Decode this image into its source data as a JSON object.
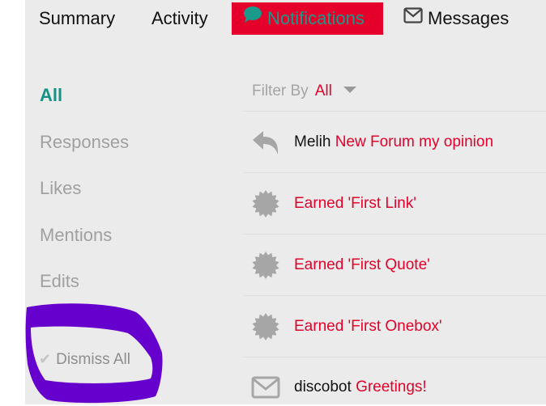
{
  "tabs": {
    "summary": "Summary",
    "activity": "Activity",
    "notifications": "Notifications",
    "messages": "Messages"
  },
  "nav": {
    "all": "All",
    "responses": "Responses",
    "likes": "Likes",
    "mentions": "Mentions",
    "edits": "Edits",
    "dismiss_all": "Dismiss All"
  },
  "filter": {
    "label": "Filter By",
    "value": "All"
  },
  "notifications": [
    {
      "icon": "reply-icon",
      "who": "Melih",
      "what": "New Forum my opinion"
    },
    {
      "icon": "badge-icon",
      "who": "",
      "what": "Earned 'First Link'"
    },
    {
      "icon": "badge-icon",
      "who": "",
      "what": "Earned 'First Quote'"
    },
    {
      "icon": "badge-icon",
      "who": "",
      "what": "Earned 'First Onebox'"
    },
    {
      "icon": "envelope-icon",
      "who": "discobot",
      "what": "Greetings!"
    }
  ],
  "colors": {
    "accent_red": "#e4002b",
    "teal": "#149283",
    "annotation_purple": "#6600cc"
  }
}
